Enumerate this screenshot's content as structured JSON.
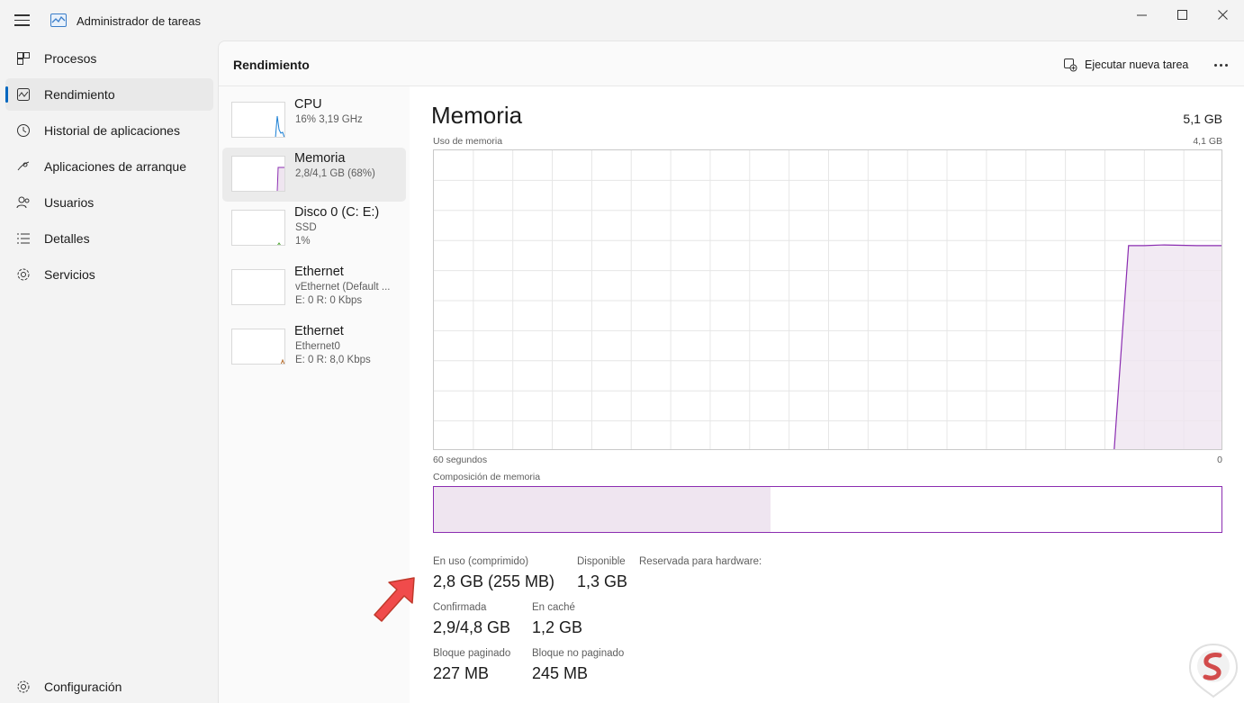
{
  "window": {
    "title": "Administrador de tareas"
  },
  "nav": {
    "items": [
      {
        "label": "Procesos",
        "icon": "processes-icon"
      },
      {
        "label": "Rendimiento",
        "icon": "performance-icon"
      },
      {
        "label": "Historial de aplicaciones",
        "icon": "history-icon"
      },
      {
        "label": "Aplicaciones de arranque",
        "icon": "startup-icon"
      },
      {
        "label": "Usuarios",
        "icon": "users-icon"
      },
      {
        "label": "Detalles",
        "icon": "details-icon"
      },
      {
        "label": "Servicios",
        "icon": "services-icon"
      }
    ],
    "active_index": 1,
    "config_label": "Configuración"
  },
  "header": {
    "title": "Rendimiento",
    "run_task_label": "Ejecutar nueva tarea"
  },
  "devices": [
    {
      "name": "CPU",
      "sub1": "16% 3,19 GHz",
      "sub2": "",
      "color": "#1a7fd4"
    },
    {
      "name": "Memoria",
      "sub1": "2,8/4,1 GB (68%)",
      "sub2": "",
      "color": "#8b2db1"
    },
    {
      "name": "Disco 0 (C: E:)",
      "sub1": "SSD",
      "sub2": "1%",
      "color": "#4da431"
    },
    {
      "name": "Ethernet",
      "sub1": "vEthernet (Default ...",
      "sub2": "E: 0 R: 0 Kbps",
      "color": "#b46b2a"
    },
    {
      "name": "Ethernet",
      "sub1": "Ethernet0",
      "sub2": "E: 0 R: 8,0 Kbps",
      "color": "#b46b2a"
    }
  ],
  "memory": {
    "title": "Memoria",
    "total": "5,1 GB",
    "usage_label": "Uso de memoria",
    "usage_max": "4,1 GB",
    "x_left": "60 segundos",
    "x_right": "0",
    "composition_label": "Composición de memoria",
    "composition_used_fraction": 0.427,
    "accent": "#8b2db1",
    "fill": "#efe5f0"
  },
  "chart_data": {
    "type": "area",
    "title": "",
    "xlabel": "",
    "ylabel": "Uso de memoria",
    "x": [
      60,
      8.3,
      7.2,
      6.0,
      4.5,
      2,
      0
    ],
    "y": [
      0,
      0,
      2.8,
      2.8,
      2.81,
      2.8,
      2.8
    ],
    "xlim": [
      60,
      0
    ],
    "ylim": [
      0,
      4.1
    ],
    "grid": true,
    "series": [
      {
        "values": [
          0,
          0,
          2.8,
          2.8,
          2.81,
          2.8,
          2.8
        ]
      }
    ]
  },
  "stats": {
    "in_use_label": "En uso (comprimido)",
    "in_use_value": "2,8 GB (255 MB)",
    "available_label": "Disponible",
    "available_value": "1,3 GB",
    "reserved_label": "Reservada para hardware:",
    "committed_label": "Confirmada",
    "committed_value": "2,9/4,8 GB",
    "cached_label": "En caché",
    "cached_value": "1,2 GB",
    "paged_label": "Bloque paginado",
    "paged_value": "227 MB",
    "nonpaged_label": "Bloque no paginado",
    "nonpaged_value": "245 MB"
  }
}
